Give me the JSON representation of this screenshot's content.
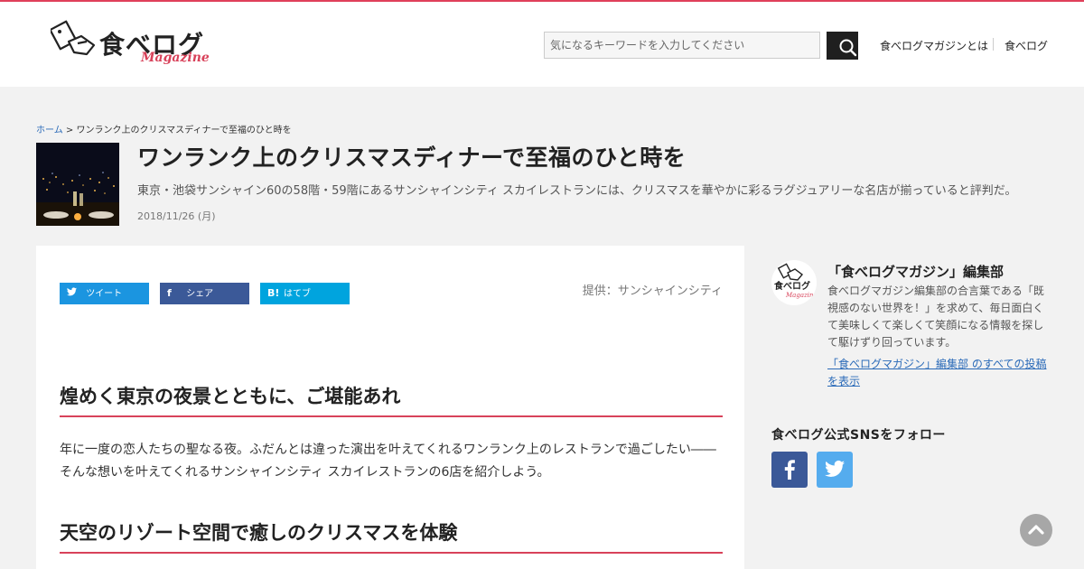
{
  "header": {
    "logo_text": "食べログ",
    "logo_sub": "Magazine",
    "search_placeholder": "気になるキーワードを入力してください",
    "nav": [
      "食べログマガジンとは",
      "食べログ"
    ]
  },
  "breadcrumb": {
    "home": "ホーム",
    "sep": ">",
    "current": "ワンランク上のクリスマスディナーで至福のひと時を"
  },
  "article": {
    "title": "ワンランク上のクリスマスディナーで至福のひと時を",
    "lead": "東京・池袋サンシャイン60の58階・59階にあるサンシャインシティ スカイレストランには、クリスマスを華やかに彩るラグジュアリーな名店が揃っていると評判だ。",
    "date": "2018/11/26 (月)",
    "share": {
      "tweet": "ツイート",
      "share": "シェア",
      "hatena_icon": "B!",
      "hatena": "はてブ"
    },
    "credit": "提供：サンシャインシティ",
    "heading1": "煌めく東京の夜景とともに、ご堪能あれ",
    "paragraph1": "年に一度の恋人たちの聖なる夜。ふだんとは違った演出を叶えてくれるワンランク上のレストランで過ごしたい――そんな想いを叶えてくれるサンシャインシティ スカイレストランの6店を紹介しよう。",
    "heading2": "天空のリゾート空間で癒しのクリスマスを体験"
  },
  "sidebar": {
    "author_name": "「食べログマガジン」編集部",
    "author_bio": "食べログマガジン編集部の合言葉である「既視感のない世界を！」を求めて、毎日面白くて美味しくて楽しくて笑顔になる情報を探して駆けずり回っています。",
    "author_link": "「食べログマガジン」編集部 のすべての投稿を表示",
    "sns_title": "食べログ公式SNSをフォロー",
    "sns_icons": [
      "facebook-icon",
      "twitter-icon"
    ]
  },
  "colors": {
    "accent": "#d8425a",
    "link": "#2a6ab8",
    "twitter": "#1b95e0",
    "facebook": "#3b5998",
    "hatena": "#00a4de"
  }
}
